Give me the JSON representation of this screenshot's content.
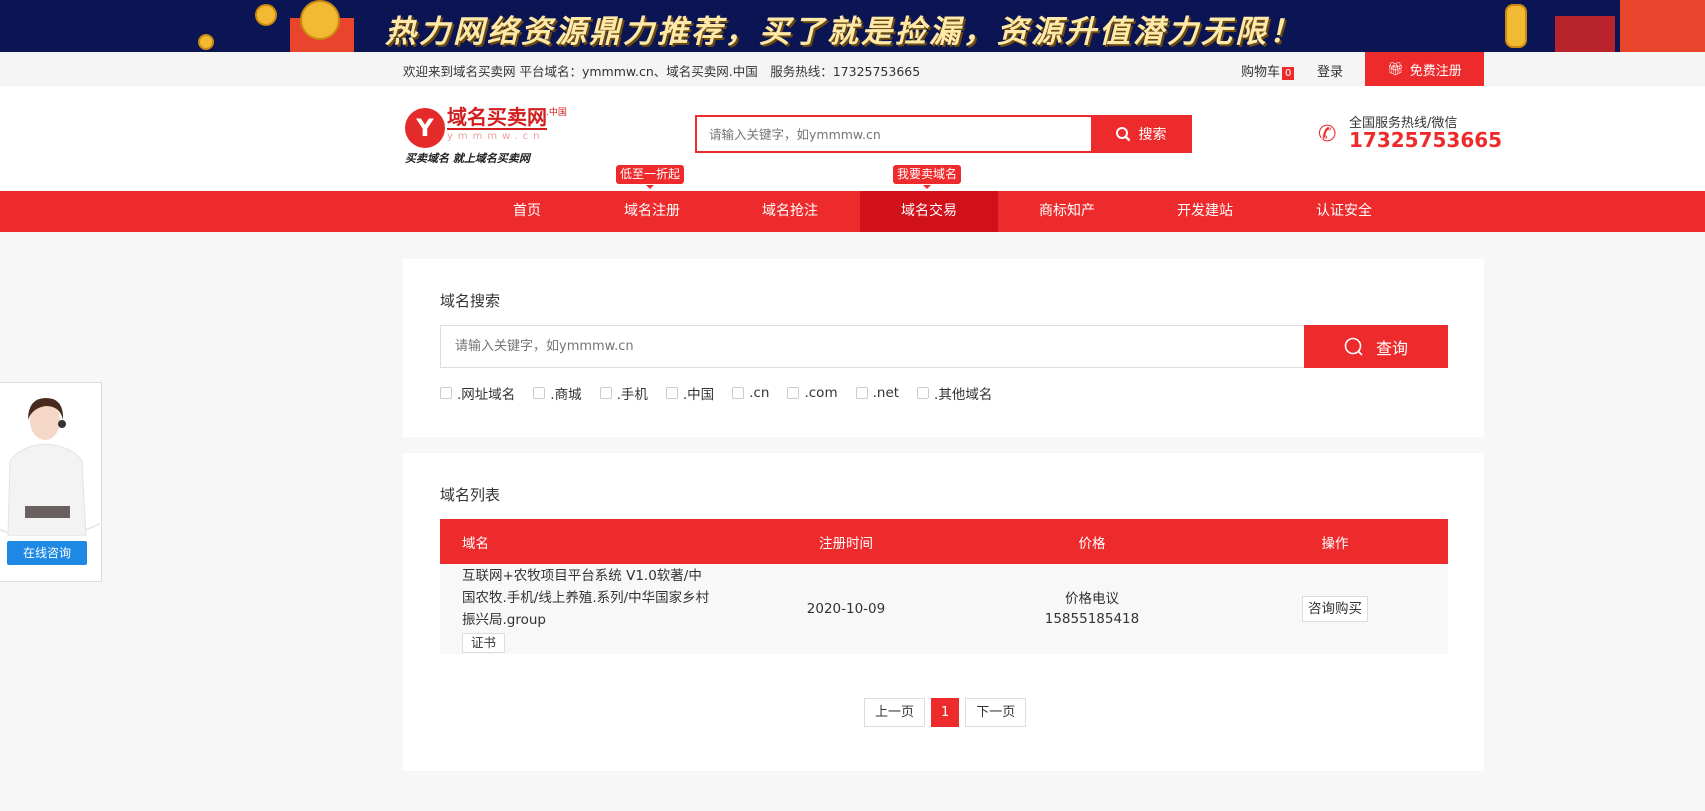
{
  "banner": {
    "slogan": "热力网络资源鼎力推荐，买了就是捡漏，资源升值潜力无限！"
  },
  "topbar": {
    "welcome": "欢迎来到域名买卖网 平台域名：ymmmw.cn、域名买卖网.中国　服务热线：17325753665",
    "cart_label": "购物车",
    "cart_count": "0",
    "login": "登录",
    "register": "免费注册"
  },
  "header": {
    "logo": {
      "name": "域名买卖网",
      "suffix": ".中国",
      "domain": "ymmmw.cn",
      "tagline": "买卖域名 就上域名买卖网"
    },
    "search_placeholder": "请输入关键字，如ymmmw.cn",
    "search_button": "搜索",
    "hotline_label": "全国服务热线/微信",
    "hotline_number": "17325753665"
  },
  "tips": {
    "register": "低至一折起",
    "trade": "我要卖域名"
  },
  "nav": [
    "首页",
    "域名注册",
    "域名抢注",
    "域名交易",
    "商标知产",
    "开发建站",
    "认证安全"
  ],
  "search_card": {
    "title": "域名搜索",
    "placeholder": "请输入关键字，如ymmmw.cn",
    "button": "查询",
    "filters": [
      ".网址域名",
      ".商城",
      ".手机",
      ".中国",
      ".cn",
      ".com",
      ".net",
      ".其他域名"
    ]
  },
  "list_card": {
    "title": "域名列表",
    "columns": [
      "域名",
      "注册时间",
      "价格",
      "操作"
    ],
    "rows": [
      {
        "name": "互联网+农牧项目平台系统 V1.0软著/中国农牧.手机/线上养殖.系列/中华国家乡村振兴局.group",
        "cert": "证书",
        "date": "2020-10-09",
        "price": "价格电议",
        "phone": "15855185418",
        "action": "咨询购买"
      }
    ],
    "pager": {
      "prev": "上一页",
      "current": "1",
      "next": "下一页"
    }
  },
  "kefu": {
    "button": "在线咨询"
  },
  "colors": {
    "brand": "#ee2b2c",
    "nav_active": "#d0111a",
    "kefu": "#1e88e5"
  }
}
